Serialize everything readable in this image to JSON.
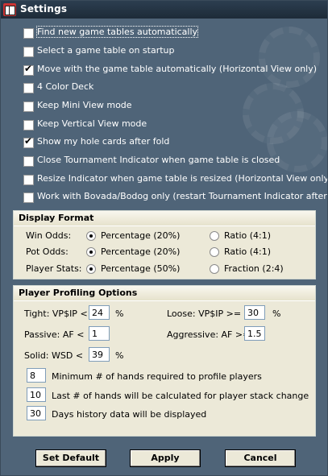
{
  "window": {
    "title": "Settings"
  },
  "options": [
    {
      "label": "Find new game tables automatically",
      "checked": false
    },
    {
      "label": "Select a game table on startup",
      "checked": false
    },
    {
      "label": "Move with the game table automatically (Horizontal View only)",
      "checked": true
    },
    {
      "label": "4 Color Deck",
      "checked": false
    },
    {
      "label": "Keep Mini View mode",
      "checked": false
    },
    {
      "label": "Keep Vertical View mode",
      "checked": false
    },
    {
      "label": "Show my hole cards after fold",
      "checked": true
    },
    {
      "label": "Close Tournament Indicator when game table is closed",
      "checked": false
    },
    {
      "label": "Resize Indicator when game table is resized (Horizontal View only)",
      "checked": false
    },
    {
      "label": "Work with Bovada/Bodog only (restart Tournament Indicator after change)",
      "checked": false
    }
  ],
  "display_format": {
    "title": "Display Format",
    "rows": [
      {
        "label": "Win Odds:",
        "opt1": "Percentage (20%)",
        "opt2": "Ratio (4:1)",
        "selected": 1
      },
      {
        "label": "Pot Odds:",
        "opt1": "Percentage (20%)",
        "opt2": "Ratio (4:1)",
        "selected": 1
      },
      {
        "label": "Player Stats:",
        "opt1": "Percentage (50%)",
        "opt2": "Fraction (2:4)",
        "selected": 1
      }
    ]
  },
  "profiling": {
    "title": "Player Profiling Options",
    "tight_label": "Tight:  VP$IP <",
    "tight_value": "24",
    "tight_unit": "%",
    "loose_label": "Loose:   VP$IP >=",
    "loose_value": "30",
    "loose_unit": "%",
    "passive_label": "Passive:   AF <",
    "passive_value": "1",
    "aggressive_label": "Aggressive:  AF >=",
    "aggressive_value": "1.5",
    "solid_label": "Solid:   WSD <",
    "solid_value": "39",
    "solid_unit": "%",
    "min_hands_value": "8",
    "min_hands_label": "Minimum # of hands required to profile players",
    "last_hands_value": "10",
    "last_hands_label": "Last # of hands will be calculated for player stack change",
    "days_value": "30",
    "days_label": "Days history data will be displayed"
  },
  "buttons": {
    "default": "Set Default",
    "apply": "Apply",
    "cancel": "Cancel"
  }
}
